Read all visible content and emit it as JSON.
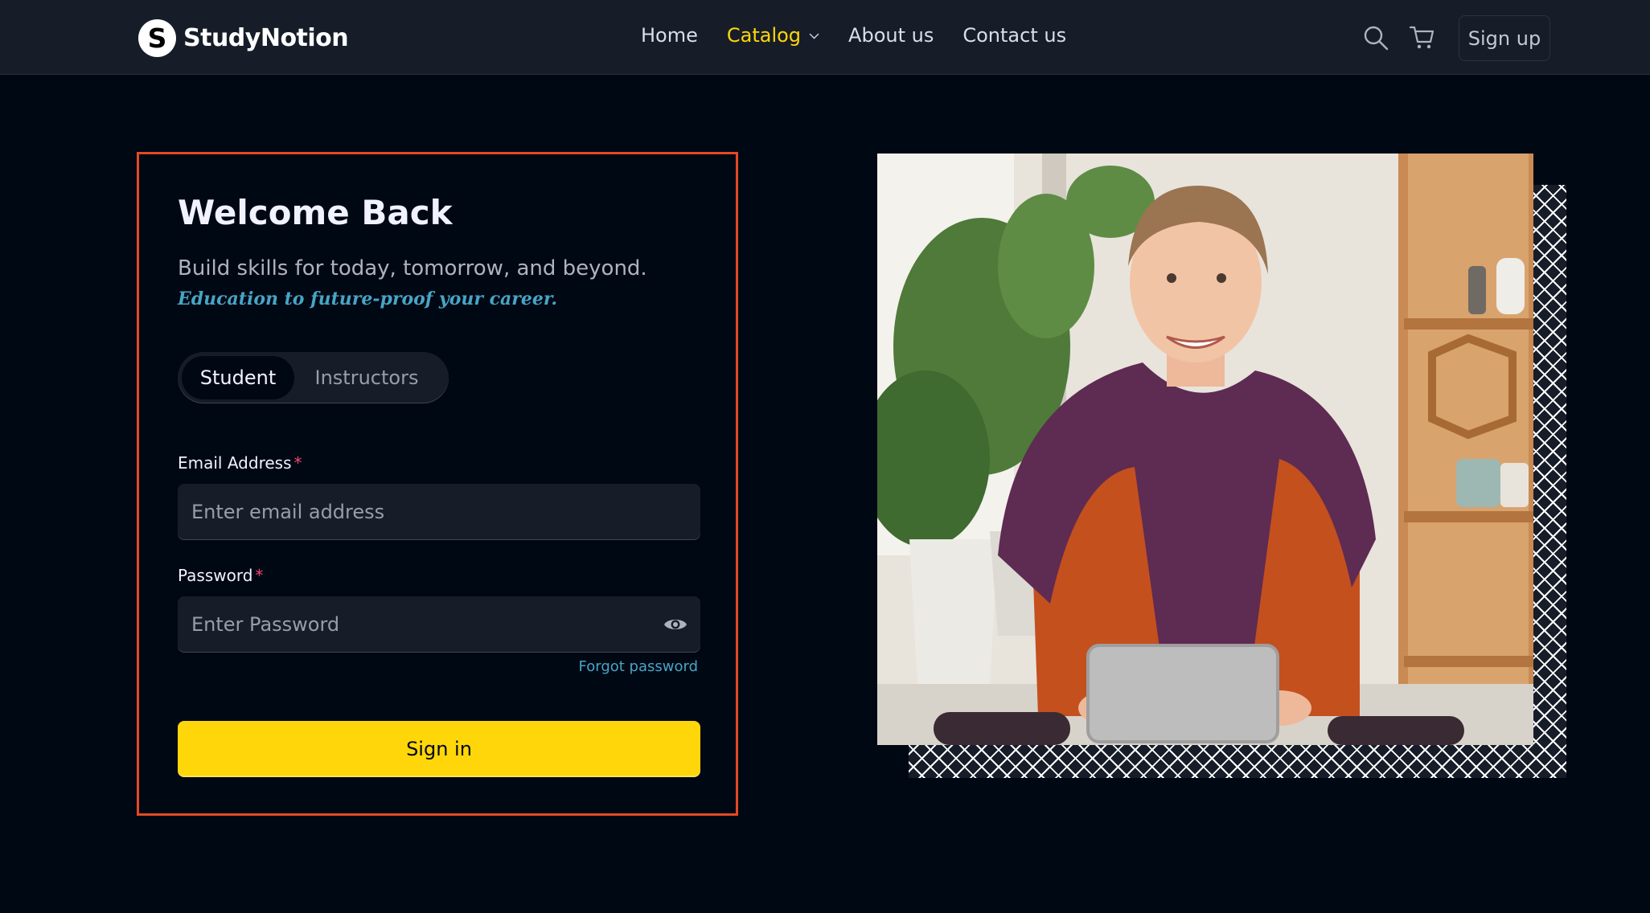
{
  "nav": {
    "logo_mark": "S",
    "brand": "StudyNotion",
    "links": [
      {
        "label": "Home",
        "active": false
      },
      {
        "label": "Catalog",
        "active": true,
        "dropdown": true
      },
      {
        "label": "About us",
        "active": false
      },
      {
        "label": "Contact us",
        "active": false
      }
    ],
    "icons": [
      "search-icon",
      "cart-icon"
    ],
    "signup_label": "Sign up"
  },
  "login": {
    "title": "Welcome Back",
    "subtitle": "Build skills for today, tomorrow, and beyond.",
    "subtitle_highlight": "Education to future-proof your career.",
    "tabs": [
      {
        "label": "Student",
        "selected": true
      },
      {
        "label": "Instructors",
        "selected": false
      }
    ],
    "email": {
      "label": "Email Address",
      "required_mark": "*",
      "placeholder": "Enter email address",
      "value": ""
    },
    "password": {
      "label": "Password",
      "required_mark": "*",
      "placeholder": "Enter Password",
      "value": ""
    },
    "forgot_label": "Forgot password",
    "signin_label": "Sign in"
  },
  "colors": {
    "page_bg": "#000814",
    "nav_bg": "#161D29",
    "accent_yellow": "#FFD60A",
    "accent_blue": "#47A5C5",
    "card_border": "#E24A24",
    "required_pink": "#EF476F"
  }
}
